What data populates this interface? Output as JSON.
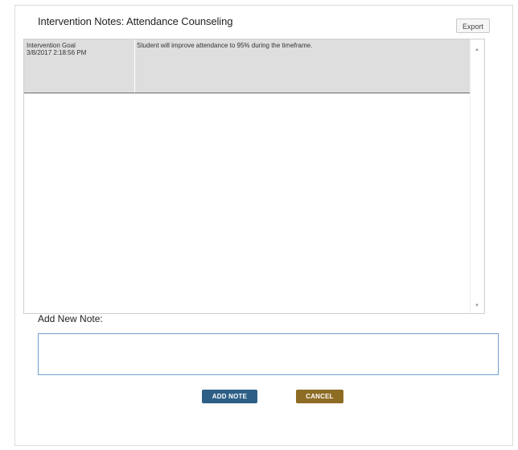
{
  "dialog": {
    "title": "Intervention Notes: Attendance Counseling",
    "export_label": "Export"
  },
  "notes": [
    {
      "type": "Intervention Goal",
      "timestamp": "3/8/2017 2:18:56 PM",
      "text": "Student will improve attendance to 95% during the timeframe."
    }
  ],
  "add_note": {
    "label": "Add New Note:",
    "value": "",
    "placeholder": ""
  },
  "buttons": {
    "add_note": "ADD NOTE",
    "cancel": "CANCEL"
  },
  "colors": {
    "add_note_bg": "#2d5f86",
    "cancel_bg": "#8d6c24",
    "note_row_bg": "#dedede",
    "input_border": "#6f9fd0"
  }
}
